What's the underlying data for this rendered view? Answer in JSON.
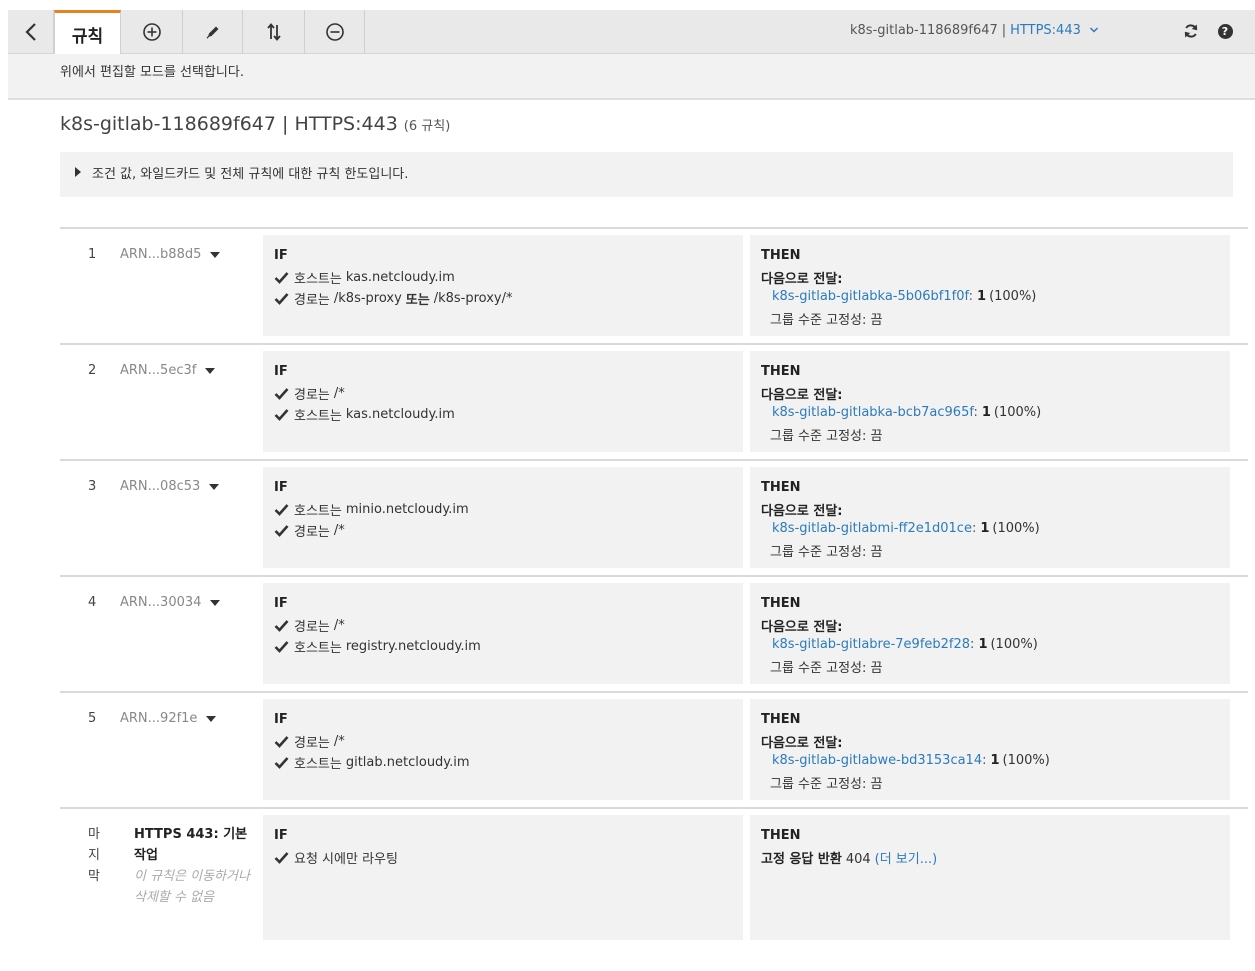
{
  "toolbar": {
    "back_icon": "chevron-left-icon",
    "rules_tab_label": "규칙",
    "add_icon": "plus-circle-icon",
    "edit_icon": "pencil-icon",
    "reorder_icon": "sort-arrows-icon",
    "delete_icon": "minus-circle-icon",
    "load_balancer": "k8s-gitlab-118689f647",
    "separator": "|",
    "listener": "HTTPS:443",
    "refresh_icon": "refresh-icon",
    "help_icon": "help-icon",
    "help_glyph": "?",
    "accent_color": "#e7811d"
  },
  "mode_bar": {
    "text": "위에서 편집할 모드를 선택합니다."
  },
  "heading": {
    "title": "k8s-gitlab-118689f647 | HTTPS:443",
    "count": "(6 규칙)"
  },
  "limits": {
    "text": "조건 값, 와일드카드 및 전체 규칙에 대한 규칙 한도입니다."
  },
  "labels": {
    "if": "IF",
    "then": "THEN",
    "forward_to": "다음으로 전달:",
    "stickiness": "그룹 수준 고정성: 끔",
    "or": "또는"
  },
  "rules": [
    {
      "number": "1",
      "arn": "ARN...b88d5",
      "conditions": [
        {
          "prefix": "호스트는",
          "value": "kas.netcloudy.im",
          "or_value": ""
        },
        {
          "prefix": "경로는",
          "value": "/k8s-proxy",
          "or_value": "/k8s-proxy/*"
        }
      ],
      "target": "k8s-gitlab-gitlabka-5b06bf1f0f",
      "weight": "1",
      "percent": "(100%)"
    },
    {
      "number": "2",
      "arn": "ARN...5ec3f",
      "conditions": [
        {
          "prefix": "경로는",
          "value": "/*",
          "or_value": ""
        },
        {
          "prefix": "호스트는",
          "value": "kas.netcloudy.im",
          "or_value": ""
        }
      ],
      "target": "k8s-gitlab-gitlabka-bcb7ac965f",
      "weight": "1",
      "percent": "(100%)"
    },
    {
      "number": "3",
      "arn": "ARN...08c53",
      "conditions": [
        {
          "prefix": "호스트는",
          "value": "minio.netcloudy.im",
          "or_value": ""
        },
        {
          "prefix": "경로는",
          "value": "/*",
          "or_value": ""
        }
      ],
      "target": "k8s-gitlab-gitlabmi-ff2e1d01ce",
      "weight": "1",
      "percent": "(100%)"
    },
    {
      "number": "4",
      "arn": "ARN...30034",
      "conditions": [
        {
          "prefix": "경로는",
          "value": "/*",
          "or_value": ""
        },
        {
          "prefix": "호스트는",
          "value": "registry.netcloudy.im",
          "or_value": ""
        }
      ],
      "target": "k8s-gitlab-gitlabre-7e9feb2f28",
      "weight": "1",
      "percent": "(100%)"
    },
    {
      "number": "5",
      "arn": "ARN...92f1e",
      "conditions": [
        {
          "prefix": "경로는",
          "value": "/*",
          "or_value": ""
        },
        {
          "prefix": "호스트는",
          "value": "gitlab.netcloudy.im",
          "or_value": ""
        }
      ],
      "target": "k8s-gitlab-gitlabwe-bd3153ca14",
      "weight": "1",
      "percent": "(100%)"
    }
  ],
  "default_rule": {
    "number": "마지막",
    "title": "HTTPS 443: 기본 작업",
    "note": "이 규칙은 이동하거나 삭제할 수 없음",
    "condition": "요청 시에만 라우팅",
    "action_label": "고정 응답 반환",
    "status_code": "404",
    "more_link": "(더 보기...)"
  }
}
